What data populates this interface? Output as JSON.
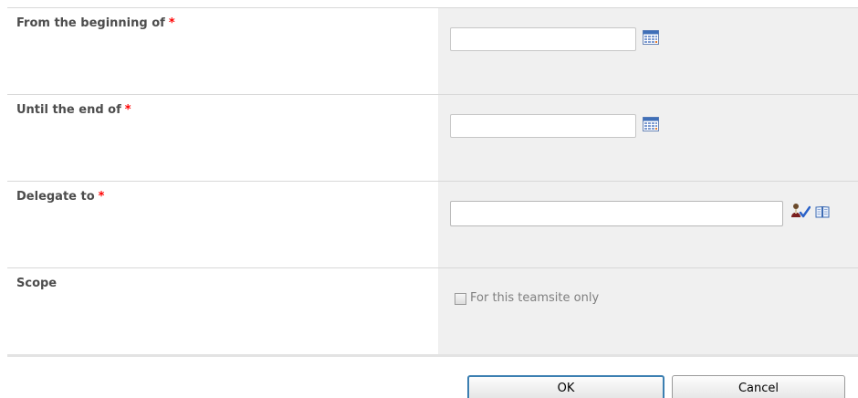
{
  "form": {
    "rows": [
      {
        "label": "From the beginning of",
        "required_mark": "*",
        "value": ""
      },
      {
        "label": "Until the end of",
        "required_mark": "*",
        "value": ""
      },
      {
        "label": "Delegate to",
        "required_mark": "*",
        "value": ""
      },
      {
        "label": "Scope",
        "checkbox_label": "For this teamsite only",
        "checked": false
      }
    ]
  },
  "buttons": {
    "ok_label": "OK",
    "cancel_label": "Cancel"
  },
  "icons": {
    "date_picker": "calendar-icon",
    "check_names": "check-names-icon",
    "browse": "address-book-icon"
  }
}
